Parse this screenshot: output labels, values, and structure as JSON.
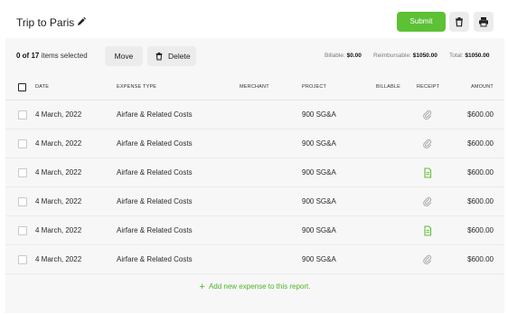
{
  "header": {
    "title": "Trip to Paris",
    "submit_label": "Submit"
  },
  "toolbar": {
    "selected_count": "0 of 17",
    "selected_suffix": " items selected",
    "move_label": "Move",
    "delete_label": "Delete",
    "billable_label": "Billable: ",
    "billable_value": "$0.00",
    "reimbursable_label": "Reimbursable: ",
    "reimbursable_value": "$1050.00",
    "total_label": "Total: ",
    "total_value": "$1050.00"
  },
  "table": {
    "columns": {
      "date": "DATE",
      "type": "EXPENSE TYPE",
      "merchant": "MERCHANT",
      "project": "PROJECT",
      "billable": "BILLABLE",
      "receipt": "RECEIPT",
      "amount": "AMOUNT"
    },
    "rows": [
      {
        "date": "4 March, 2022",
        "type": "Airfare & Related Costs",
        "project": "900 SG&A",
        "receipt": "paperclip-icon",
        "amount": "$600.00"
      },
      {
        "date": "4 March, 2022",
        "type": "Airfare & Related Costs",
        "project": "900 SG&A",
        "receipt": "paperclip-icon",
        "amount": "$600.00"
      },
      {
        "date": "4 March, 2022",
        "type": "Airfare & Related Costs",
        "project": "900 SG&A",
        "receipt": "document-icon",
        "amount": "$600.00"
      },
      {
        "date": "4 March, 2022",
        "type": "Airfare & Related Costs",
        "project": "900 SG&A",
        "receipt": "paperclip-icon",
        "amount": "$600.00"
      },
      {
        "date": "4 March, 2022",
        "type": "Airfare & Related Costs",
        "project": "900 SG&A",
        "receipt": "document-icon",
        "amount": "$600.00"
      },
      {
        "date": "4 March, 2022",
        "type": "Airfare & Related Costs",
        "project": "900 SG&A",
        "receipt": "paperclip-icon",
        "amount": "$600.00"
      }
    ],
    "add_label": "Add new expense to this report."
  },
  "colors": {
    "accent": "#5cc135",
    "paperclip": "#a0a0a0",
    "document": "#5cc135"
  }
}
